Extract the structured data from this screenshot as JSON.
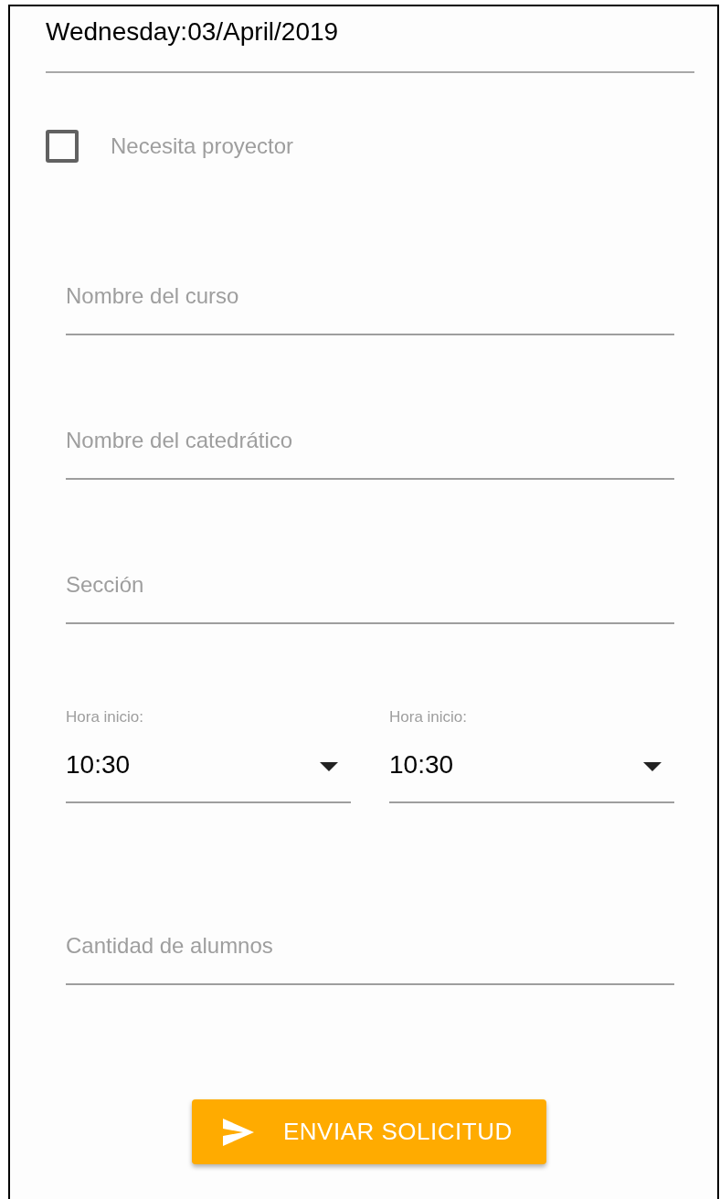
{
  "date": "Wednesday:03/April/2019",
  "projector": {
    "label": "Necesita proyector",
    "checked": false
  },
  "fields": [
    {
      "placeholder": "Nombre del curso"
    },
    {
      "placeholder": "Nombre del catedrático"
    },
    {
      "placeholder": "Sección"
    }
  ],
  "time_selects": [
    {
      "label": "Hora inicio:",
      "value": "10:30"
    },
    {
      "label": "Hora inicio:",
      "value": "10:30"
    }
  ],
  "students_field": {
    "placeholder": "Cantidad de alumnos"
  },
  "submit_button": {
    "label": "ENVIAR SOLICITUD"
  }
}
